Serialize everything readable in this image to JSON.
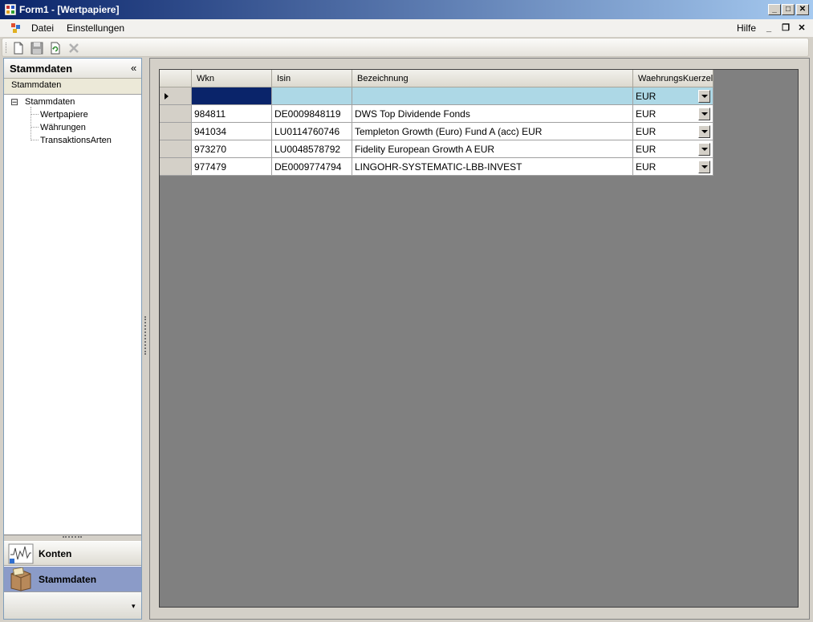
{
  "window": {
    "title": "Form1 - [Wertpapiere]",
    "buttons": {
      "minimize": "_",
      "maximize": "□",
      "close": "✕"
    }
  },
  "menu": {
    "items": [
      {
        "label": "Datei"
      },
      {
        "label": "Einstellungen"
      }
    ],
    "help": "Hilfe",
    "mdi": {
      "minimize": "_",
      "restore": "❐",
      "close": "✕"
    }
  },
  "toolbar": {
    "icons": [
      "new-document-icon",
      "save-icon",
      "refresh-icon",
      "delete-icon"
    ]
  },
  "navigation": {
    "header": "Stammdaten",
    "collapse_glyph": "«",
    "subheader": "Stammdaten",
    "tree": {
      "root": {
        "expander": "⊟",
        "label": "Stammdaten"
      },
      "children": [
        {
          "label": "Wertpapiere"
        },
        {
          "label": "Währungen"
        },
        {
          "label": "TransaktionsArten"
        }
      ]
    },
    "buttons": [
      {
        "label": "Konten"
      },
      {
        "label": "Stammdaten"
      }
    ],
    "overflow_glyph": "▾"
  },
  "grid": {
    "columns": [
      "Wkn",
      "Isin",
      "Bezeichnung",
      "WaehrungsKuerzel"
    ],
    "rows": [
      {
        "wkn": "",
        "isin": "",
        "bezeichnung": "",
        "waehrung": "EUR"
      },
      {
        "wkn": "984811",
        "isin": "DE0009848119",
        "bezeichnung": "DWS Top Dividende Fonds",
        "waehrung": "EUR"
      },
      {
        "wkn": "941034",
        "isin": "LU0114760746",
        "bezeichnung": "Templeton Growth (Euro) Fund A (acc) EUR",
        "waehrung": "EUR"
      },
      {
        "wkn": "973270",
        "isin": "LU0048578792",
        "bezeichnung": "Fidelity European Growth A EUR",
        "waehrung": "EUR"
      },
      {
        "wkn": "977479",
        "isin": "DE0009774794",
        "bezeichnung": "LINGOHR-SYSTEMATIC-LBB-INVEST",
        "waehrung": "EUR"
      }
    ]
  },
  "colors": {
    "title_start": "#0a246a",
    "title_end": "#a6caf0",
    "selected_row": "#add8e6",
    "current_cell": "#0a246a",
    "grid_background": "#808080",
    "active_nav_button": "#8b9bc8"
  }
}
